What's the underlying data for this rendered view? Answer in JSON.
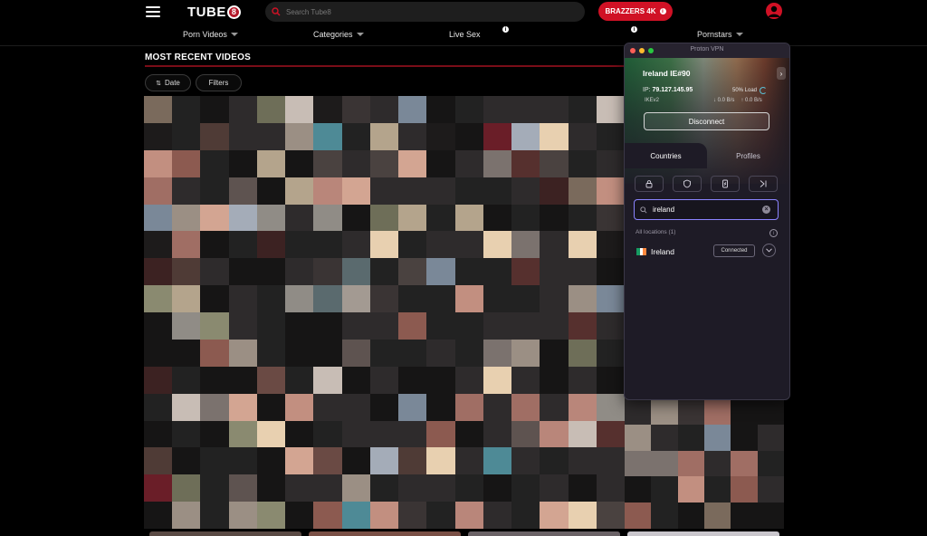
{
  "header": {
    "logo_text": "TUBE",
    "logo_badge": "8",
    "search_placeholder": "Search Tube8",
    "brazzers_label": "BRAZZERS 4K",
    "brazzers_info": "i",
    "nav": [
      {
        "label": "Porn Videos"
      },
      {
        "label": "Categories"
      },
      {
        "label": "Live Sex"
      },
      {
        "label": "Pornstars"
      }
    ],
    "info_glyph": "i",
    "accent_color": "#d01125"
  },
  "main": {
    "section_title": "MOST RECENT VIDEOS",
    "date_button": "Date",
    "date_icon": "⇅",
    "filters_button": "Filters"
  },
  "vpn": {
    "title": "Proton VPN",
    "server": "Ireland IE#90",
    "ip_label": "IP:",
    "ip_value": "79.127.145.95",
    "load": "50% Load",
    "protocol": "IKEv2",
    "download": "0.0 B/s",
    "upload": "0.0 B/s",
    "disconnect_label": "Disconnect",
    "tabs": [
      {
        "label": "Countries",
        "active": true
      },
      {
        "label": "Profiles",
        "active": false
      }
    ],
    "search_value": "ireland",
    "locations_header": "All locations (1)",
    "locations": [
      {
        "name": "Ireland",
        "status": "Connected",
        "flag_colors": [
          "#169b62",
          "#ffffff",
          "#ff883e"
        ]
      }
    ],
    "arrow": "›",
    "clear_glyph": "×",
    "info_glyph": "i"
  }
}
